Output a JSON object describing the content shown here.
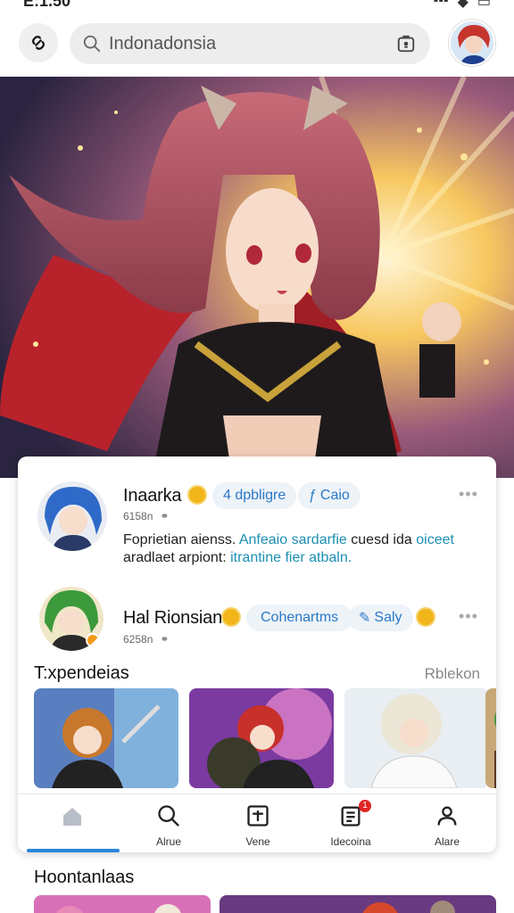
{
  "status": {
    "time": "E:1.50"
  },
  "search": {
    "value": "Indonadonsia"
  },
  "posts": [
    {
      "name": "Inaarka",
      "meta": "6158n",
      "pills": [
        "4 dpbligre",
        "Caio"
      ],
      "text_plain": "Foprietian aienss.",
      "text_hl": "Anfeaio sardarfie",
      "text_plain2": "cuesd ida",
      "text_hl2": "oiceet",
      "text_plain3": "aradlaet arpiont:",
      "text_hl3": "itrantine fier atbaln."
    },
    {
      "name": "Hal Rionsian",
      "meta": "6258n",
      "pills": [
        "Cohenartms",
        "Saly"
      ]
    }
  ],
  "section": {
    "title": "T:xpendeias",
    "more": "Rblekon"
  },
  "tabs": [
    {
      "icon": "home-icon",
      "label": ""
    },
    {
      "icon": "search-icon",
      "label": "Alrue"
    },
    {
      "icon": "plus-box-icon",
      "label": "Vene"
    },
    {
      "icon": "notes-icon",
      "label": "Idecoina",
      "badge": "1"
    },
    {
      "icon": "profile-icon",
      "label": "Alare"
    }
  ],
  "bottom": {
    "title": "Hoontanlaas"
  },
  "colors": {
    "accent": "#2a86d8",
    "link": "#1b8fb0",
    "pill_bg": "#eef3f8"
  }
}
